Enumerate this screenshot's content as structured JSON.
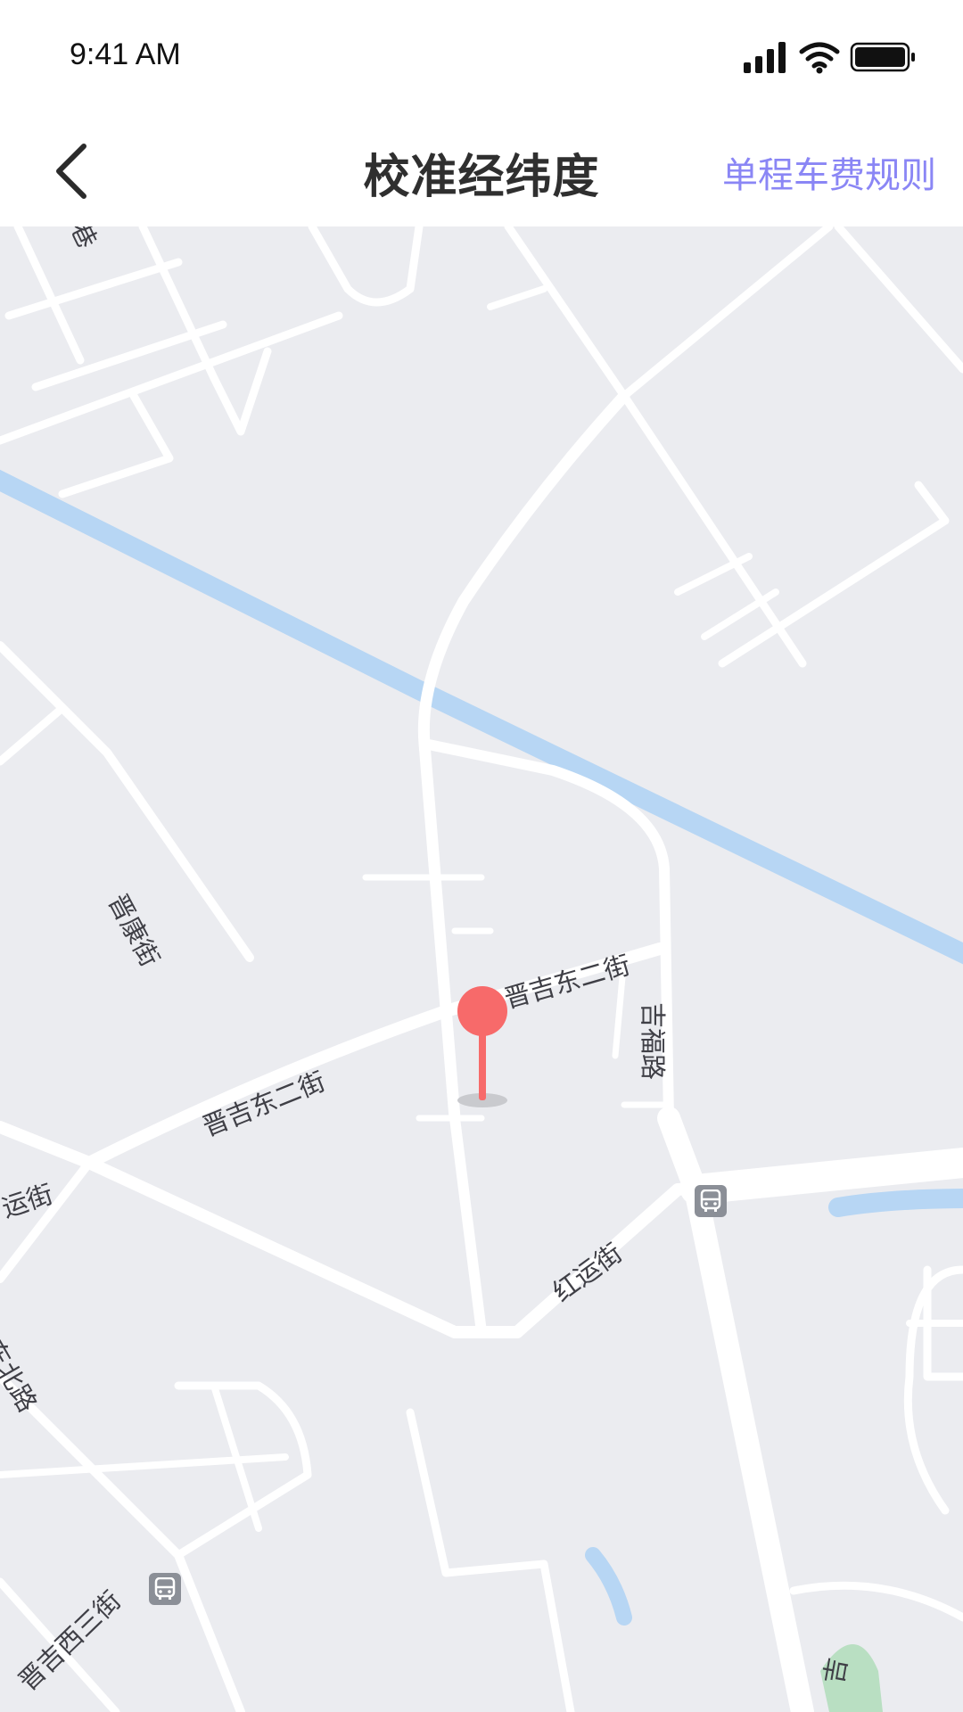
{
  "status_bar": {
    "time": "9:41 AM"
  },
  "nav": {
    "title": "校准经纬度",
    "action_label": "单程车费规则"
  },
  "map": {
    "road_labels": [
      "晋康街",
      "晋吉东二街",
      "晋吉东二街",
      "吉福路",
      "红运街",
      "运街",
      "东北路",
      "晋吉西三街",
      "吉",
      "巷"
    ]
  },
  "colors": {
    "accent": "#8a86f5",
    "pin": "#f76a6a",
    "river": "#b7d6f4",
    "map_bg": "#ebecf0",
    "park": "#b9dfc2"
  }
}
